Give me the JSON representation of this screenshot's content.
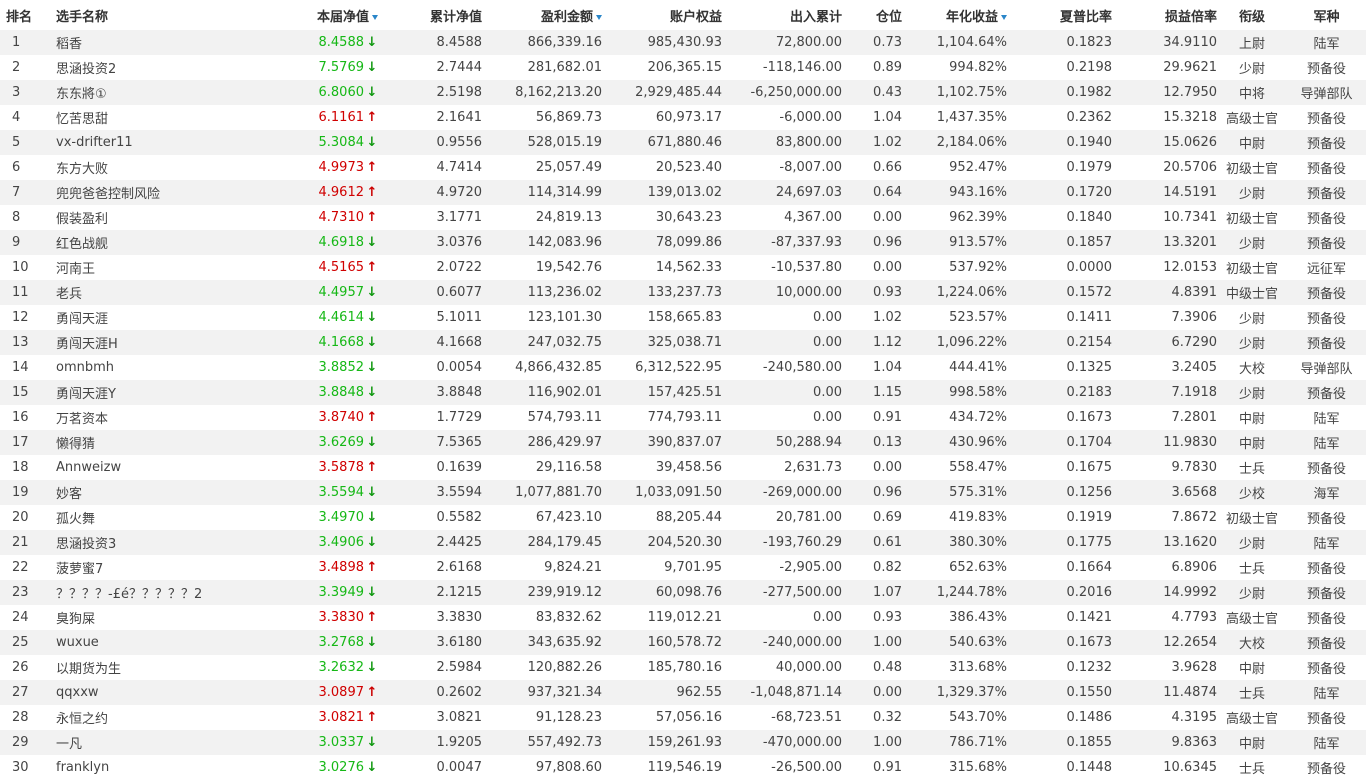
{
  "headers": {
    "rank": "排名",
    "name": "选手名称",
    "nav": "本届净值",
    "cum_nav": "累计净值",
    "profit": "盈利金额",
    "equity": "账户权益",
    "flow": "出入累计",
    "position": "仓位",
    "annual": "年化收益",
    "sharpe": "夏普比率",
    "pl_ratio": "损益倍率",
    "grade": "衔级",
    "branch": "军种"
  },
  "colors": {
    "up": "#d00000",
    "down": "#16b816",
    "sort_arrow": "#2a86c9",
    "stripe": "#f2f2f2"
  },
  "icons": {
    "up": "arrow-up-icon",
    "down": "arrow-down-icon",
    "sort": "sort-desc-icon"
  },
  "rows": [
    {
      "rank": "1",
      "name": "稻香",
      "nav": "8.4588",
      "trend": "down",
      "cum_nav": "8.4588",
      "profit": "866,339.16",
      "equity": "985,430.93",
      "flow": "72,800.00",
      "position": "0.73",
      "annual": "1,104.64%",
      "sharpe": "0.1823",
      "pl_ratio": "34.9110",
      "grade": "上尉",
      "branch": "陆军"
    },
    {
      "rank": "2",
      "name": "思涵投资2",
      "nav": "7.5769",
      "trend": "down",
      "cum_nav": "2.7444",
      "profit": "281,682.01",
      "equity": "206,365.15",
      "flow": "-118,146.00",
      "position": "0.89",
      "annual": "994.82%",
      "sharpe": "0.2198",
      "pl_ratio": "29.9621",
      "grade": "少尉",
      "branch": "预备役"
    },
    {
      "rank": "3",
      "name": "东东將①",
      "nav": "6.8060",
      "trend": "down",
      "cum_nav": "2.5198",
      "profit": "8,162,213.20",
      "equity": "2,929,485.44",
      "flow": "-6,250,000.00",
      "position": "0.43",
      "annual": "1,102.75%",
      "sharpe": "0.1982",
      "pl_ratio": "12.7950",
      "grade": "中将",
      "branch": "导弹部队"
    },
    {
      "rank": "4",
      "name": "忆苦思甜",
      "nav": "6.1161",
      "trend": "up",
      "cum_nav": "2.1641",
      "profit": "56,869.73",
      "equity": "60,973.17",
      "flow": "-6,000.00",
      "position": "1.04",
      "annual": "1,437.35%",
      "sharpe": "0.2362",
      "pl_ratio": "15.3218",
      "grade": "高级士官",
      "branch": "预备役"
    },
    {
      "rank": "5",
      "name": "vx-drifter11",
      "nav": "5.3084",
      "trend": "down",
      "cum_nav": "0.9556",
      "profit": "528,015.19",
      "equity": "671,880.46",
      "flow": "83,800.00",
      "position": "1.02",
      "annual": "2,184.06%",
      "sharpe": "0.1940",
      "pl_ratio": "15.0626",
      "grade": "中尉",
      "branch": "预备役"
    },
    {
      "rank": "6",
      "name": "东方大败",
      "nav": "4.9973",
      "trend": "up",
      "cum_nav": "4.7414",
      "profit": "25,057.49",
      "equity": "20,523.40",
      "flow": "-8,007.00",
      "position": "0.66",
      "annual": "952.47%",
      "sharpe": "0.1979",
      "pl_ratio": "20.5706",
      "grade": "初级士官",
      "branch": "预备役"
    },
    {
      "rank": "7",
      "name": "兜兜爸爸控制风险",
      "nav": "4.9612",
      "trend": "up",
      "cum_nav": "4.9720",
      "profit": "114,314.99",
      "equity": "139,013.02",
      "flow": "24,697.03",
      "position": "0.64",
      "annual": "943.16%",
      "sharpe": "0.1720",
      "pl_ratio": "14.5191",
      "grade": "少尉",
      "branch": "预备役"
    },
    {
      "rank": "8",
      "name": "假装盈利",
      "nav": "4.7310",
      "trend": "up",
      "cum_nav": "3.1771",
      "profit": "24,819.13",
      "equity": "30,643.23",
      "flow": "4,367.00",
      "position": "0.00",
      "annual": "962.39%",
      "sharpe": "0.1840",
      "pl_ratio": "10.7341",
      "grade": "初级士官",
      "branch": "预备役"
    },
    {
      "rank": "9",
      "name": "红色战舰",
      "nav": "4.6918",
      "trend": "down",
      "cum_nav": "3.0376",
      "profit": "142,083.96",
      "equity": "78,099.86",
      "flow": "-87,337.93",
      "position": "0.96",
      "annual": "913.57%",
      "sharpe": "0.1857",
      "pl_ratio": "13.3201",
      "grade": "少尉",
      "branch": "预备役"
    },
    {
      "rank": "10",
      "name": "河南王",
      "nav": "4.5165",
      "trend": "up",
      "cum_nav": "2.0722",
      "profit": "19,542.76",
      "equity": "14,562.33",
      "flow": "-10,537.80",
      "position": "0.00",
      "annual": "537.92%",
      "sharpe": "0.0000",
      "pl_ratio": "12.0153",
      "grade": "初级士官",
      "branch": "远征军"
    },
    {
      "rank": "11",
      "name": "老兵",
      "nav": "4.4957",
      "trend": "down",
      "cum_nav": "0.6077",
      "profit": "113,236.02",
      "equity": "133,237.73",
      "flow": "10,000.00",
      "position": "0.93",
      "annual": "1,224.06%",
      "sharpe": "0.1572",
      "pl_ratio": "4.8391",
      "grade": "中级士官",
      "branch": "预备役"
    },
    {
      "rank": "12",
      "name": "勇闯天涯",
      "nav": "4.4614",
      "trend": "down",
      "cum_nav": "5.1011",
      "profit": "123,101.30",
      "equity": "158,665.83",
      "flow": "0.00",
      "position": "1.02",
      "annual": "523.57%",
      "sharpe": "0.1411",
      "pl_ratio": "7.3906",
      "grade": "少尉",
      "branch": "预备役"
    },
    {
      "rank": "13",
      "name": "勇闯天涯H",
      "nav": "4.1668",
      "trend": "down",
      "cum_nav": "4.1668",
      "profit": "247,032.75",
      "equity": "325,038.71",
      "flow": "0.00",
      "position": "1.12",
      "annual": "1,096.22%",
      "sharpe": "0.2154",
      "pl_ratio": "6.7290",
      "grade": "少尉",
      "branch": "预备役"
    },
    {
      "rank": "14",
      "name": "omnbmh",
      "nav": "3.8852",
      "trend": "down",
      "cum_nav": "0.0054",
      "profit": "4,866,432.85",
      "equity": "6,312,522.95",
      "flow": "-240,580.00",
      "position": "1.04",
      "annual": "444.41%",
      "sharpe": "0.1325",
      "pl_ratio": "3.2405",
      "grade": "大校",
      "branch": "导弹部队"
    },
    {
      "rank": "15",
      "name": "勇闯天涯Y",
      "nav": "3.8848",
      "trend": "down",
      "cum_nav": "3.8848",
      "profit": "116,902.01",
      "equity": "157,425.51",
      "flow": "0.00",
      "position": "1.15",
      "annual": "998.58%",
      "sharpe": "0.2183",
      "pl_ratio": "7.1918",
      "grade": "少尉",
      "branch": "预备役"
    },
    {
      "rank": "16",
      "name": "万茗资本",
      "nav": "3.8740",
      "trend": "up",
      "cum_nav": "1.7729",
      "profit": "574,793.11",
      "equity": "774,793.11",
      "flow": "0.00",
      "position": "0.91",
      "annual": "434.72%",
      "sharpe": "0.1673",
      "pl_ratio": "7.2801",
      "grade": "中尉",
      "branch": "陆军"
    },
    {
      "rank": "17",
      "name": "懒得猜",
      "nav": "3.6269",
      "trend": "down",
      "cum_nav": "7.5365",
      "profit": "286,429.97",
      "equity": "390,837.07",
      "flow": "50,288.94",
      "position": "0.13",
      "annual": "430.96%",
      "sharpe": "0.1704",
      "pl_ratio": "11.9830",
      "grade": "中尉",
      "branch": "陆军"
    },
    {
      "rank": "18",
      "name": "Annweizw",
      "nav": "3.5878",
      "trend": "up",
      "cum_nav": "0.1639",
      "profit": "29,116.58",
      "equity": "39,458.56",
      "flow": "2,631.73",
      "position": "0.00",
      "annual": "558.47%",
      "sharpe": "0.1675",
      "pl_ratio": "9.7830",
      "grade": "士兵",
      "branch": "预备役"
    },
    {
      "rank": "19",
      "name": "妙客",
      "nav": "3.5594",
      "trend": "down",
      "cum_nav": "3.5594",
      "profit": "1,077,881.70",
      "equity": "1,033,091.50",
      "flow": "-269,000.00",
      "position": "0.96",
      "annual": "575.31%",
      "sharpe": "0.1256",
      "pl_ratio": "3.6568",
      "grade": "少校",
      "branch": "海军"
    },
    {
      "rank": "20",
      "name": "孤火舞",
      "nav": "3.4970",
      "trend": "down",
      "cum_nav": "0.5582",
      "profit": "67,423.10",
      "equity": "88,205.44",
      "flow": "20,781.00",
      "position": "0.69",
      "annual": "419.83%",
      "sharpe": "0.1919",
      "pl_ratio": "7.8672",
      "grade": "初级士官",
      "branch": "预备役"
    },
    {
      "rank": "21",
      "name": "思涵投资3",
      "nav": "3.4906",
      "trend": "down",
      "cum_nav": "2.4425",
      "profit": "284,179.45",
      "equity": "204,520.30",
      "flow": "-193,760.29",
      "position": "0.61",
      "annual": "380.30%",
      "sharpe": "0.1775",
      "pl_ratio": "13.1620",
      "grade": "少尉",
      "branch": "陆军"
    },
    {
      "rank": "22",
      "name": "菠萝蜜7",
      "nav": "3.4898",
      "trend": "up",
      "cum_nav": "2.6168",
      "profit": "9,824.21",
      "equity": "9,701.95",
      "flow": "-2,905.00",
      "position": "0.82",
      "annual": "652.63%",
      "sharpe": "0.1664",
      "pl_ratio": "6.8906",
      "grade": "士兵",
      "branch": "预备役"
    },
    {
      "rank": "23",
      "name": "？？？？-£é？？？？？2",
      "nav": "3.3949",
      "trend": "down",
      "cum_nav": "2.1215",
      "profit": "239,919.12",
      "equity": "60,098.76",
      "flow": "-277,500.00",
      "position": "1.07",
      "annual": "1,244.78%",
      "sharpe": "0.2016",
      "pl_ratio": "14.9992",
      "grade": "少尉",
      "branch": "预备役"
    },
    {
      "rank": "24",
      "name": "臭狗屎",
      "nav": "3.3830",
      "trend": "up",
      "cum_nav": "3.3830",
      "profit": "83,832.62",
      "equity": "119,012.21",
      "flow": "0.00",
      "position": "0.93",
      "annual": "386.43%",
      "sharpe": "0.1421",
      "pl_ratio": "4.7793",
      "grade": "高级士官",
      "branch": "预备役"
    },
    {
      "rank": "25",
      "name": "wuxue",
      "nav": "3.2768",
      "trend": "down",
      "cum_nav": "3.6180",
      "profit": "343,635.92",
      "equity": "160,578.72",
      "flow": "-240,000.00",
      "position": "1.00",
      "annual": "540.63%",
      "sharpe": "0.1673",
      "pl_ratio": "12.2654",
      "grade": "大校",
      "branch": "预备役"
    },
    {
      "rank": "26",
      "name": "以期货为生",
      "nav": "3.2632",
      "trend": "down",
      "cum_nav": "2.5984",
      "profit": "120,882.26",
      "equity": "185,780.16",
      "flow": "40,000.00",
      "position": "0.48",
      "annual": "313.68%",
      "sharpe": "0.1232",
      "pl_ratio": "3.9628",
      "grade": "中尉",
      "branch": "预备役"
    },
    {
      "rank": "27",
      "name": "qqxxw",
      "nav": "3.0897",
      "trend": "up",
      "cum_nav": "0.2602",
      "profit": "937,321.34",
      "equity": "962.55",
      "flow": "-1,048,871.14",
      "position": "0.00",
      "annual": "1,329.37%",
      "sharpe": "0.1550",
      "pl_ratio": "11.4874",
      "grade": "士兵",
      "branch": "陆军"
    },
    {
      "rank": "28",
      "name": "永恒之约",
      "nav": "3.0821",
      "trend": "up",
      "cum_nav": "3.0821",
      "profit": "91,128.23",
      "equity": "57,056.16",
      "flow": "-68,723.51",
      "position": "0.32",
      "annual": "543.70%",
      "sharpe": "0.1486",
      "pl_ratio": "4.3195",
      "grade": "高级士官",
      "branch": "预备役"
    },
    {
      "rank": "29",
      "name": "一凡",
      "nav": "3.0337",
      "trend": "down",
      "cum_nav": "1.9205",
      "profit": "557,492.73",
      "equity": "159,261.93",
      "flow": "-470,000.00",
      "position": "1.00",
      "annual": "786.71%",
      "sharpe": "0.1855",
      "pl_ratio": "9.8363",
      "grade": "中尉",
      "branch": "陆军"
    },
    {
      "rank": "30",
      "name": "franklyn",
      "nav": "3.0276",
      "trend": "down",
      "cum_nav": "0.0047",
      "profit": "97,808.60",
      "equity": "119,546.19",
      "flow": "-26,500.00",
      "position": "0.91",
      "annual": "315.68%",
      "sharpe": "0.1448",
      "pl_ratio": "10.6345",
      "grade": "士兵",
      "branch": "预备役"
    }
  ]
}
